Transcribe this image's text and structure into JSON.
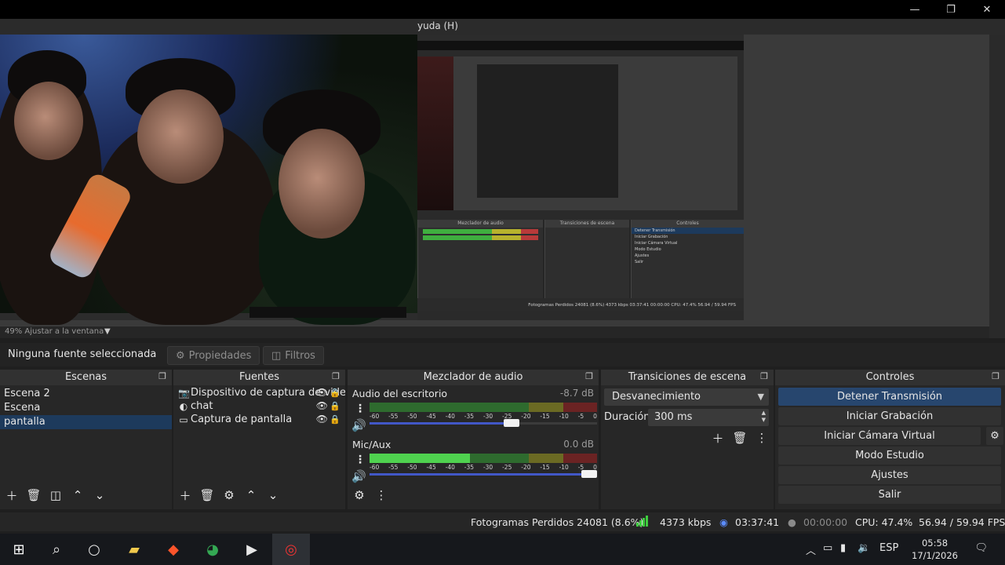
{
  "window": {
    "menu_partial": "yuda (H)",
    "buttons": {
      "minimize": "—",
      "maximize": "❐",
      "close": "✕"
    }
  },
  "preview": {
    "zoom_label": "49%  Ajustar a la ventana",
    "zoom_caret": "▼",
    "nested": {
      "mixer_title": "Mezclador de audio",
      "transitions_title": "Transiciones de escena",
      "controls_title": "Controles",
      "rows_controls": [
        "Detener Transmisión",
        "Iniciar Grabación",
        "Iniciar Cámara Virtual",
        "Modo Estudio",
        "Ajustes",
        "Salir"
      ],
      "status": "Fotogramas Perdidos 24081 (8.6%)   4373 kbps   03:37:41   00:00:00   CPU: 47.4%   56.94 / 59.94 FPS"
    }
  },
  "source_toolbar": {
    "no_source": "Ninguna fuente seleccionada",
    "properties": "Propiedades",
    "filters": "Filtros"
  },
  "docks": {
    "scenes": {
      "title": "Escenas",
      "items": [
        "Escena 2",
        "Escena",
        "pantalla"
      ],
      "selected": 2
    },
    "sources": {
      "title": "Fuentes",
      "items": [
        {
          "icon": "camera-icon",
          "label": "Dispositivo de captura de video"
        },
        {
          "icon": "browser-icon",
          "label": "chat"
        },
        {
          "icon": "monitor-icon",
          "label": "Captura de pantalla"
        }
      ]
    },
    "mixer": {
      "title": "Mezclador de audio",
      "ticks": [
        "-60",
        "-55",
        "-50",
        "-45",
        "-40",
        "-35",
        "-30",
        "-25",
        "-20",
        "-15",
        "-10",
        "-5",
        "0"
      ],
      "channels": [
        {
          "name": "Audio del escritorio",
          "db": "-8.7 dB",
          "level": 0.0,
          "volume": 0.66
        },
        {
          "name": "Mic/Aux",
          "db": "0.0 dB",
          "level": 0.44,
          "volume": 1.0
        }
      ]
    },
    "transitions": {
      "title": "Transiciones de escena",
      "selected": "Desvanecimiento",
      "duration_label": "Duración",
      "duration_value": "300 ms"
    },
    "controls": {
      "title": "Controles",
      "stop_stream": "Detener Transmisión",
      "start_recording": "Iniciar Grabación",
      "start_vcam": "Iniciar Cámara Virtual",
      "studio_mode": "Modo Estudio",
      "settings": "Ajustes",
      "exit": "Salir"
    }
  },
  "status": {
    "dropped": "Fotogramas Perdidos 24081 (8.6%)",
    "bitrate": "4373 kbps",
    "stream_time": "03:37:41",
    "rec_time": "00:00:00",
    "cpu": "CPU: 47.4%",
    "fps": "56.94 / 59.94 FPS"
  },
  "taskbar": {
    "language": "ESP",
    "time": "05:58",
    "date": "17/1/2026"
  },
  "colors": {
    "accent": "#27466e",
    "selection": "#1d3a5c",
    "meter_green": "#4fd24f",
    "volume_bar": "#4157c7"
  }
}
